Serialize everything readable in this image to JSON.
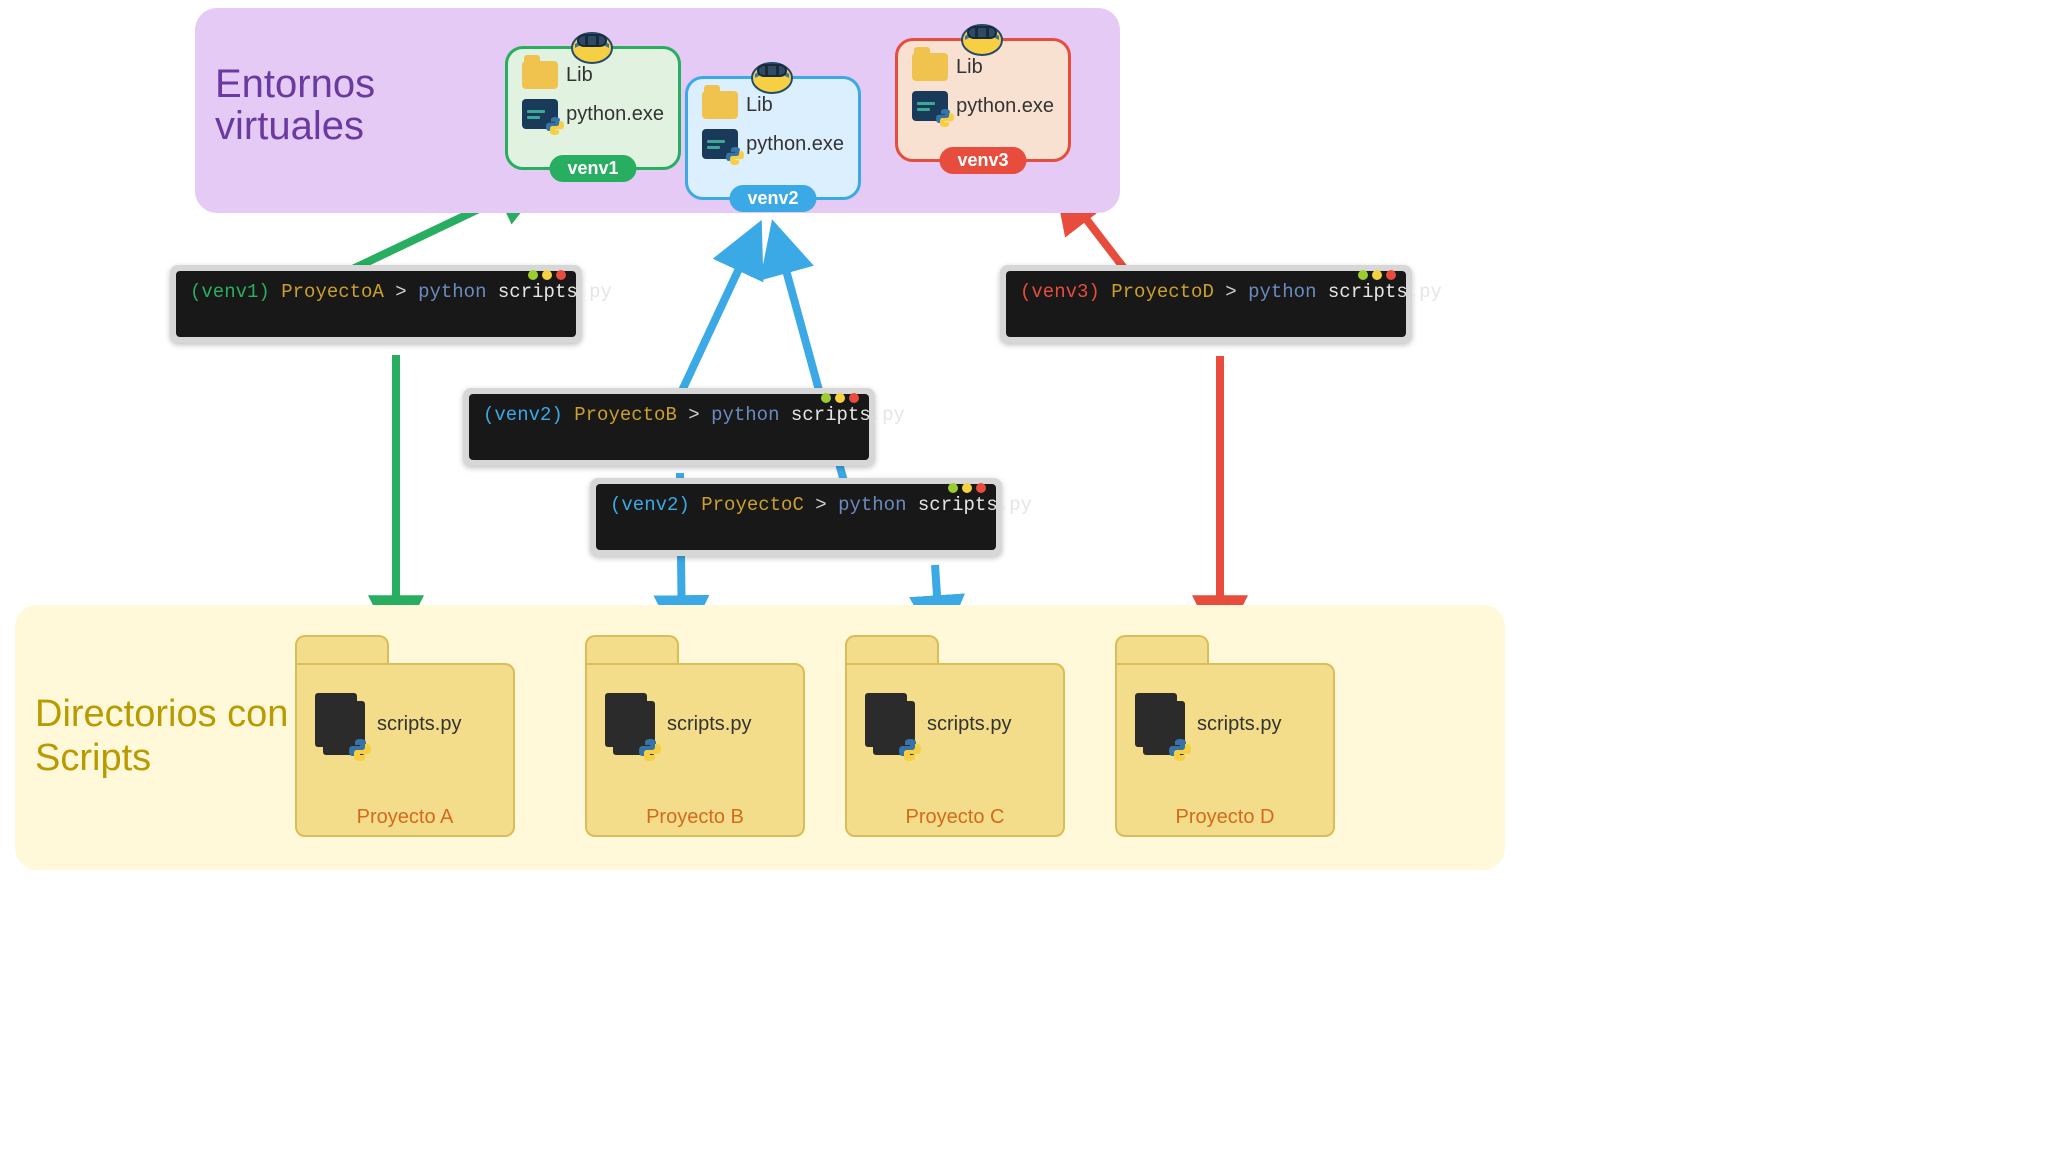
{
  "sections": {
    "venv_title": "Entornos virtuales",
    "projects_title": "Directorios con Scripts"
  },
  "venvs": [
    {
      "id": "venv1",
      "label": "venv1",
      "lib": "Lib",
      "exe": "python.exe",
      "color": "#27ae60",
      "fill": "#e2f2e1"
    },
    {
      "id": "venv2",
      "label": "venv2",
      "lib": "Lib",
      "exe": "python.exe",
      "color": "#3ba9e6",
      "fill": "#dcefff"
    },
    {
      "id": "venv3",
      "label": "venv3",
      "lib": "Lib",
      "exe": "python.exe",
      "color": "#e74c3c",
      "fill": "#f9e1d2"
    }
  ],
  "terminals": [
    {
      "id": "t1",
      "venv": "venv1",
      "venv_class": "tk-venv1",
      "dir": "ProyectoA",
      "cmd": "python",
      "arg": "scripts.py"
    },
    {
      "id": "t2",
      "venv": "venv2",
      "venv_class": "tk-venv2",
      "dir": "ProyectoB",
      "cmd": "python",
      "arg": "scripts.py"
    },
    {
      "id": "t3",
      "venv": "venv2",
      "venv_class": "tk-venv2",
      "dir": "ProyectoC",
      "cmd": "python",
      "arg": "scripts.py"
    },
    {
      "id": "t4",
      "venv": "venv3",
      "venv_class": "tk-venv3",
      "dir": "ProyectoD",
      "cmd": "python",
      "arg": "scripts.py"
    }
  ],
  "projects": [
    {
      "id": "pa",
      "label": "Proyecto A",
      "file": "scripts.py"
    },
    {
      "id": "pb",
      "label": "Proyecto B",
      "file": "scripts.py"
    },
    {
      "id": "pc",
      "label": "Proyecto C",
      "file": "scripts.py"
    },
    {
      "id": "pd",
      "label": "Proyecto D",
      "file": "scripts.py"
    }
  ],
  "colors": {
    "green": "#27ae60",
    "blue": "#3ba9e6",
    "red": "#e74c3c"
  }
}
